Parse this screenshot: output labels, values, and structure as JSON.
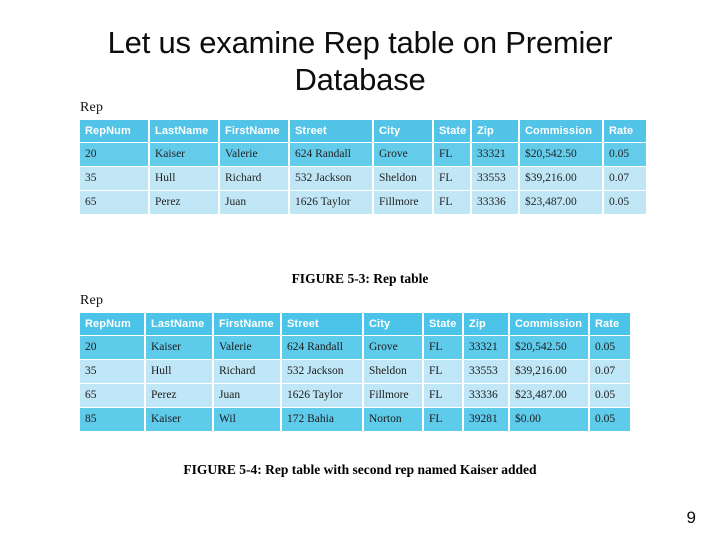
{
  "slide": {
    "title": "Let us examine Rep table on Premier Database",
    "page_number": "9",
    "background_color": "#ffffff",
    "header_color": "#4cc3e8",
    "row_band_dark": "#5fcbeb",
    "row_band_light": "#bfe7f7"
  },
  "figures": [
    {
      "table_label": "Rep",
      "caption": "FIGURE 5-3: Rep table",
      "columns": [
        "RepNum",
        "LastName",
        "FirstName",
        "Street",
        "City",
        "State",
        "Zip",
        "Commission",
        "Rate"
      ],
      "rows": [
        [
          "20",
          "Kaiser",
          "Valerie",
          "624 Randall",
          "Grove",
          "FL",
          "33321",
          "$20,542.50",
          "0.05"
        ],
        [
          "35",
          "Hull",
          "Richard",
          "532 Jackson",
          "Sheldon",
          "FL",
          "33553",
          "$39,216.00",
          "0.07"
        ],
        [
          "65",
          "Perez",
          "Juan",
          "1626 Taylor",
          "Fillmore",
          "FL",
          "33336",
          "$23,487.00",
          "0.05"
        ]
      ]
    },
    {
      "table_label": "Rep",
      "caption": "FIGURE 5-4: Rep table with second rep named Kaiser added",
      "columns": [
        "RepNum",
        "LastName",
        "FirstName",
        "Street",
        "City",
        "State",
        "Zip",
        "Commission",
        "Rate"
      ],
      "rows": [
        [
          "20",
          "Kaiser",
          "Valerie",
          "624 Randall",
          "Grove",
          "FL",
          "33321",
          "$20,542.50",
          "0.05"
        ],
        [
          "35",
          "Hull",
          "Richard",
          "532 Jackson",
          "Sheldon",
          "FL",
          "33553",
          "$39,216.00",
          "0.07"
        ],
        [
          "65",
          "Perez",
          "Juan",
          "1626 Taylor",
          "Fillmore",
          "FL",
          "33336",
          "$23,487.00",
          "0.05"
        ],
        [
          "85",
          "Kaiser",
          "Wil",
          "172 Bahia",
          "Norton",
          "FL",
          "39281",
          "$0.00",
          "0.05"
        ]
      ]
    }
  ]
}
